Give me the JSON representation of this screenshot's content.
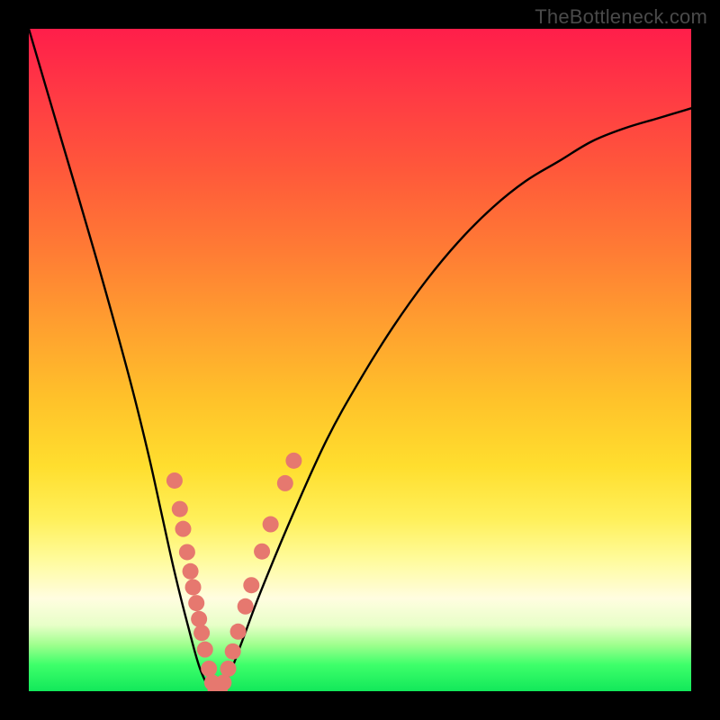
{
  "watermark": "TheBottleneck.com",
  "colors": {
    "frame": "#000000",
    "curve": "#000000",
    "marker_fill": "#e6786f",
    "marker_stroke": "#c95a52",
    "gradient_top": "#ff1e4a",
    "gradient_bottom": "#12e85a"
  },
  "chart_data": {
    "type": "line",
    "title": "",
    "xlabel": "",
    "ylabel": "",
    "xlim": [
      0,
      100
    ],
    "ylim": [
      0,
      1
    ],
    "grid": false,
    "legend": false,
    "series": [
      {
        "name": "bottleneck-curve",
        "x": [
          0,
          5,
          10,
          15,
          18,
          20,
          22,
          24,
          26,
          28,
          30,
          32,
          35,
          40,
          45,
          50,
          55,
          60,
          65,
          70,
          75,
          80,
          85,
          90,
          95,
          100
        ],
        "y": [
          1.0,
          0.83,
          0.66,
          0.48,
          0.36,
          0.27,
          0.18,
          0.1,
          0.03,
          0.0,
          0.02,
          0.07,
          0.15,
          0.27,
          0.38,
          0.47,
          0.55,
          0.62,
          0.68,
          0.73,
          0.77,
          0.8,
          0.83,
          0.85,
          0.865,
          0.88
        ]
      }
    ],
    "markers": [
      {
        "x": 22.0,
        "y": 0.318
      },
      {
        "x": 22.8,
        "y": 0.275
      },
      {
        "x": 23.3,
        "y": 0.245
      },
      {
        "x": 23.9,
        "y": 0.21
      },
      {
        "x": 24.4,
        "y": 0.181
      },
      {
        "x": 24.8,
        "y": 0.157
      },
      {
        "x": 25.3,
        "y": 0.133
      },
      {
        "x": 25.7,
        "y": 0.109
      },
      {
        "x": 26.1,
        "y": 0.088
      },
      {
        "x": 26.6,
        "y": 0.063
      },
      {
        "x": 27.2,
        "y": 0.034
      },
      {
        "x": 27.7,
        "y": 0.013
      },
      {
        "x": 28.2,
        "y": 0.003
      },
      {
        "x": 28.8,
        "y": 0.002
      },
      {
        "x": 29.4,
        "y": 0.013
      },
      {
        "x": 30.1,
        "y": 0.034
      },
      {
        "x": 30.8,
        "y": 0.06
      },
      {
        "x": 31.6,
        "y": 0.09
      },
      {
        "x": 32.7,
        "y": 0.128
      },
      {
        "x": 33.6,
        "y": 0.16
      },
      {
        "x": 35.2,
        "y": 0.211
      },
      {
        "x": 36.5,
        "y": 0.252
      },
      {
        "x": 38.7,
        "y": 0.314
      },
      {
        "x": 40.0,
        "y": 0.348
      }
    ]
  }
}
